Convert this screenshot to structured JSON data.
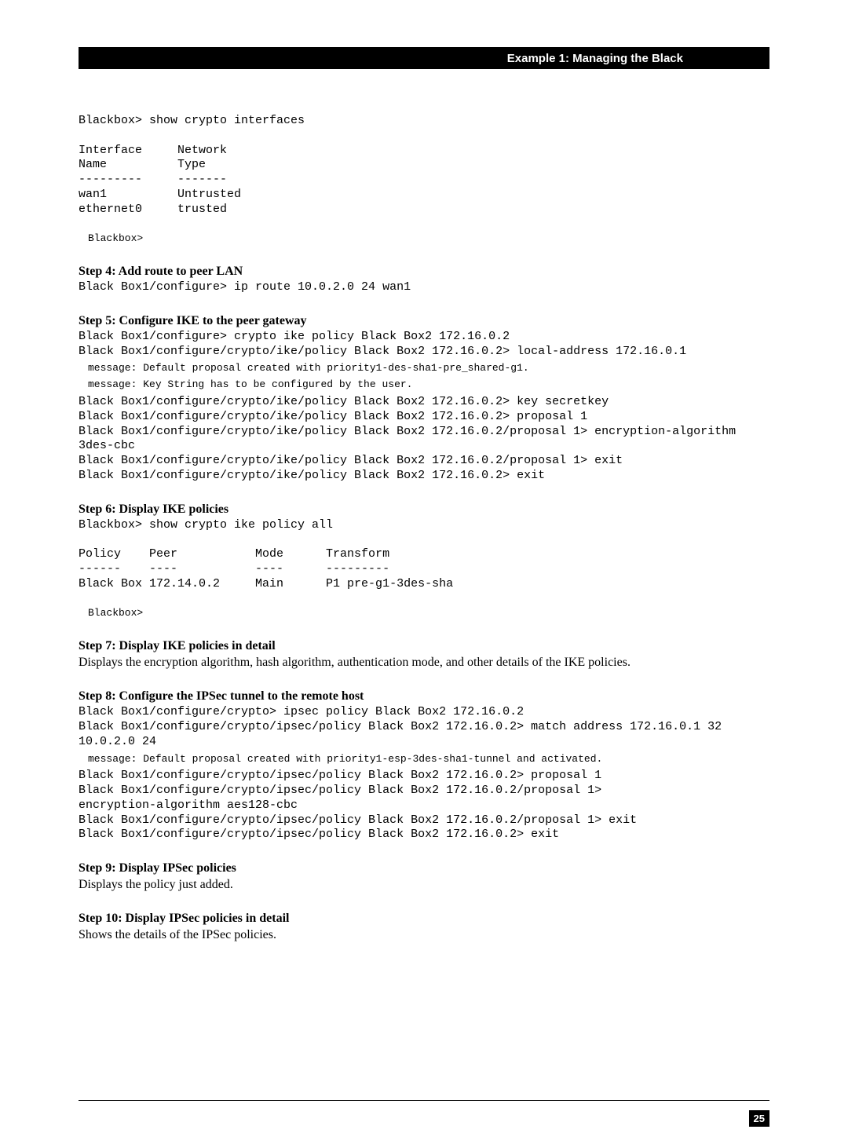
{
  "header": {
    "title": "Example 1: Managing the Black"
  },
  "block1": "Blackbox> show crypto interfaces\n\nInterface     Network\nName          Type\n---------     -------\nwan1          Untrusted\nethernet0     trusted",
  "prompt1": "Blackbox>",
  "step4": {
    "heading": "Step 4: Add route to peer LAN",
    "code": "Black Box1/configure> ip route 10.0.2.0 24 wan1"
  },
  "step5": {
    "heading": "Step 5: Configure IKE to the peer gateway",
    "code1": "Black Box1/configure> crypto ike policy Black Box2 172.16.0.2\nBlack Box1/configure/crypto/ike/policy Black Box2 172.16.0.2> local-address 172.16.0.1",
    "msg1": "message: Default proposal created with priority1-des-sha1-pre_shared-g1.",
    "msg2": "message: Key String has to be configured by the user.",
    "code2": "Black Box1/configure/crypto/ike/policy Black Box2 172.16.0.2> key secretkey\nBlack Box1/configure/crypto/ike/policy Black Box2 172.16.0.2> proposal 1\nBlack Box1/configure/crypto/ike/policy Black Box2 172.16.0.2/proposal 1> encryption-algorithm\n3des-cbc\nBlack Box1/configure/crypto/ike/policy Black Box2 172.16.0.2/proposal 1> exit\nBlack Box1/configure/crypto/ike/policy Black Box2 172.16.0.2> exit"
  },
  "step6": {
    "heading": "Step 6: Display IKE policies",
    "code": "Blackbox> show crypto ike policy all\n\nPolicy    Peer           Mode      Transform\n------    ----           ----      ---------\nBlack Box 172.14.0.2     Main      P1 pre-g1-3des-sha",
    "prompt": "Blackbox>"
  },
  "step7": {
    "heading": "Step 7: Display IKE policies in detail",
    "text": "Displays the encryption algorithm, hash algorithm, authentication mode, and other details of the IKE policies."
  },
  "step8": {
    "heading": "Step 8: Configure the IPSec tunnel to the remote host",
    "code1": "Black Box1/configure/crypto> ipsec policy Black Box2 172.16.0.2\nBlack Box1/configure/crypto/ipsec/policy Black Box2 172.16.0.2> match address 172.16.0.1 32\n10.0.2.0 24",
    "msg1": "message: Default proposal created with priority1-esp-3des-sha1-tunnel and activated.",
    "code2": "Black Box1/configure/crypto/ipsec/policy Black Box2 172.16.0.2> proposal 1\nBlack Box1/configure/crypto/ipsec/policy Black Box2 172.16.0.2/proposal 1>\nencryption-algorithm aes128-cbc\nBlack Box1/configure/crypto/ipsec/policy Black Box2 172.16.0.2/proposal 1> exit\nBlack Box1/configure/crypto/ipsec/policy Black Box2 172.16.0.2> exit"
  },
  "step9": {
    "heading": "Step 9: Display IPSec policies",
    "text": "Displays the policy just added."
  },
  "step10": {
    "heading": "Step 10: Display IPSec policies in detail",
    "text": "Shows the details of the IPSec policies."
  },
  "page_number": "25"
}
